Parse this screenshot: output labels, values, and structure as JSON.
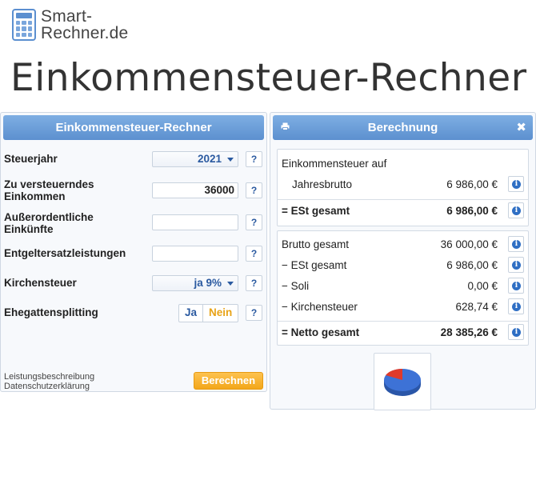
{
  "brand": {
    "name_line1": "Smart-",
    "name_line2": "Rechner.de",
    "logo_icon": "calculator-icon"
  },
  "page_title": "Einkommensteuer-Rechner",
  "input_panel": {
    "title": "Einkommensteuer-Rechner",
    "fields": {
      "steuerjahr": {
        "label": "Steuerjahr",
        "value": "2021"
      },
      "zve": {
        "label_line1": "Zu versteuerndes",
        "label_line2": "Einkommen",
        "value": "36000"
      },
      "ausserordentlich": {
        "label_line1": "Außerordentliche",
        "label_line2": "Einkünfte",
        "value": ""
      },
      "entgeltersatz": {
        "label": "Entgeltersatzleistungen",
        "value": ""
      },
      "kirchensteuer": {
        "label": "Kirchensteuer",
        "value": "ja 9%"
      },
      "ehegattensplitting": {
        "label": "Ehegattensplitting",
        "option_yes": "Ja",
        "option_no": "Nein",
        "selected": "Nein"
      }
    },
    "help_label": "?",
    "links": [
      "Leistungsbeschreibung",
      "Datenschutzerklärung"
    ],
    "calculate_button": "Berechnen"
  },
  "result_panel": {
    "title": "Berechnung",
    "close_label": "✖",
    "section1": {
      "heading": "Einkommensteuer auf",
      "rows": [
        {
          "label": "Jahresbrutto",
          "value": "6 986,00 €"
        },
        {
          "label": "= ESt gesamt",
          "value": "6 986,00 €"
        }
      ]
    },
    "section2": {
      "rows": [
        {
          "label": "Brutto gesamt",
          "value": "36 000,00 €"
        },
        {
          "label": "− ESt gesamt",
          "value": "6 986,00 €"
        },
        {
          "label": "− Soli",
          "value": "0,00 €"
        },
        {
          "label": "− Kirchensteuer",
          "value": "628,74 €"
        },
        {
          "label": "= Netto gesamt",
          "value": "28 385,26 €"
        }
      ]
    },
    "info_icon": "info-icon",
    "pie_colors": {
      "tax": "#e03a2b",
      "net": "#3d72d6"
    }
  }
}
